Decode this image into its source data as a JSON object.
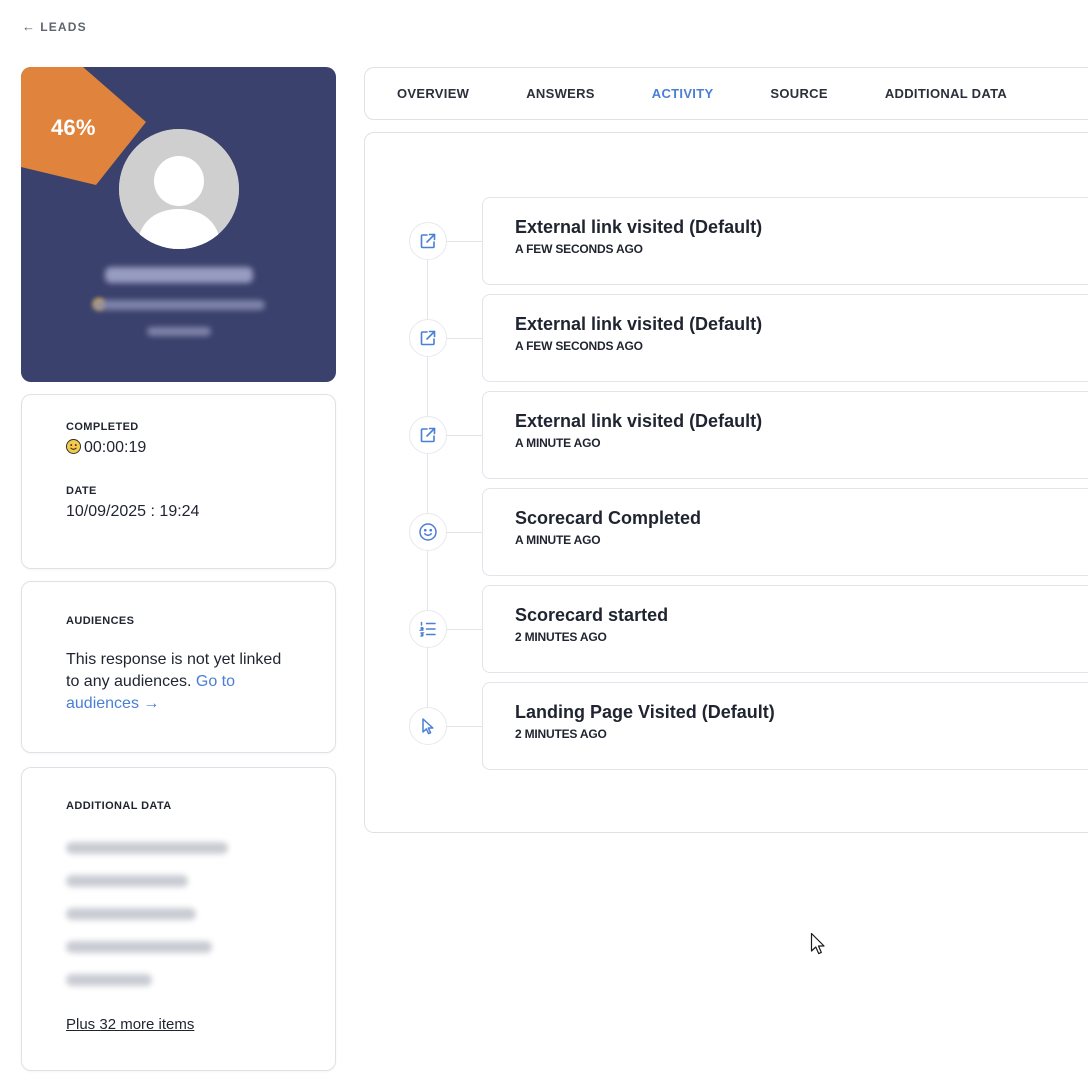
{
  "back": {
    "label": "LEADS"
  },
  "profile": {
    "score": "46%",
    "name": "Bear Kolmann",
    "email": "bear@example.com",
    "extra": "Ireland",
    "colors": {
      "background": "#3a416c",
      "score_banner": "#e0843d",
      "avatar": "#cfcfcf"
    }
  },
  "completed": {
    "label": "COMPLETED",
    "value": "00:00:19"
  },
  "date": {
    "label": "DATE",
    "value": "10/09/2025 : 19:24"
  },
  "audiences": {
    "label": "AUDIENCES",
    "text": "This response is not yet linked to any audiences.",
    "link": "Go to audiences →"
  },
  "additional": {
    "label": "ADDITIONAL DATA",
    "more": "Plus 32 more items"
  },
  "tabs": [
    {
      "label": "OVERVIEW"
    },
    {
      "label": "ANSWERS"
    },
    {
      "label": "ACTIVITY",
      "active": true
    },
    {
      "label": "SOURCE"
    },
    {
      "label": "ADDITIONAL DATA"
    }
  ],
  "activity": [
    {
      "icon": "external-link-icon",
      "title": "External link visited (Default)",
      "time": "A FEW SECONDS AGO"
    },
    {
      "icon": "external-link-icon",
      "title": "External link visited (Default)",
      "time": "A FEW SECONDS AGO"
    },
    {
      "icon": "external-link-icon",
      "title": "External link visited (Default)",
      "time": "A MINUTE AGO"
    },
    {
      "icon": "smiley-icon",
      "title": "Scorecard Completed",
      "time": "A MINUTE AGO"
    },
    {
      "icon": "list-icon",
      "title": "Scorecard started",
      "time": "2 MINUTES AGO"
    },
    {
      "icon": "pointer-icon",
      "title": "Landing Page Visited (Default)",
      "time": "2 MINUTES AGO"
    }
  ],
  "accent_color": "#4a7fd6"
}
